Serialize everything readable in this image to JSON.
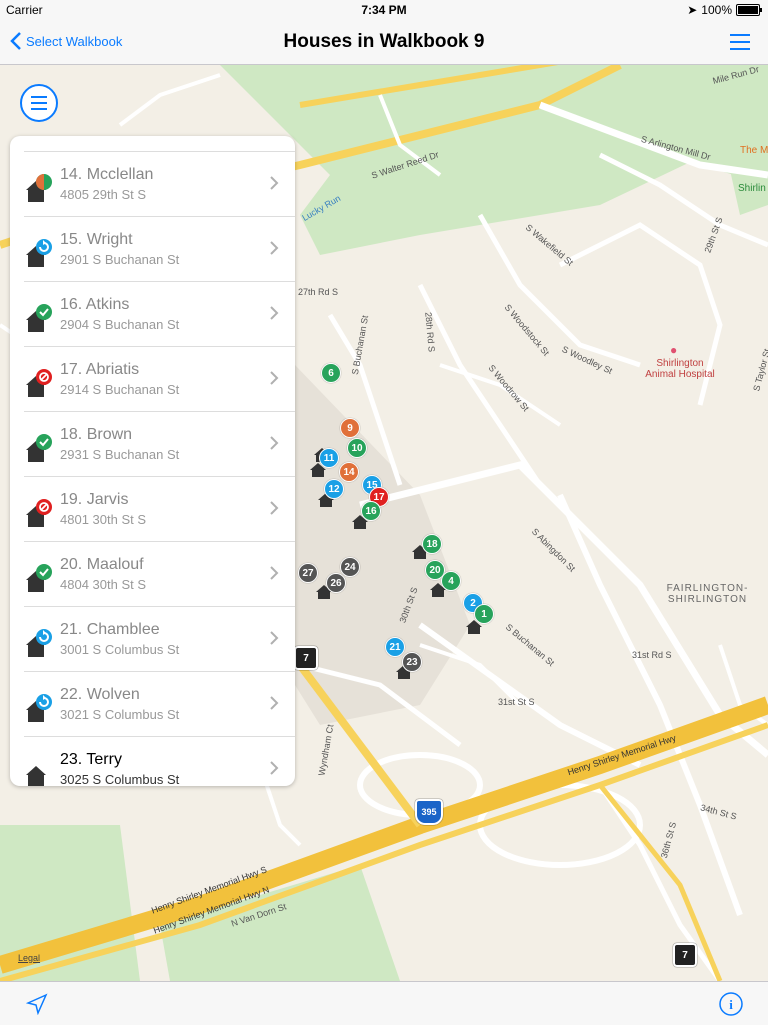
{
  "status": {
    "carrier": "Carrier",
    "time": "7:34 PM",
    "battery": "100%"
  },
  "nav": {
    "back_label": "Select Walkbook",
    "title": "Houses in Walkbook 9"
  },
  "colors": {
    "accent": "#0a7bff",
    "green": "#27a35b",
    "blue": "#1aa0e6",
    "red": "#e02020",
    "orange": "#e0703a",
    "dark": "#555555"
  },
  "houses": [
    {
      "label": "14. Mcclellan",
      "address": "4805 29th St S",
      "status": "split",
      "icon": "house-split-icon",
      "active": false
    },
    {
      "label": "15. Wright",
      "address": "2901 S Buchanan St",
      "status": "revisit",
      "icon": "house-revisit-icon",
      "active": false
    },
    {
      "label": "16. Atkins",
      "address": "2904 S Buchanan St",
      "status": "done",
      "icon": "house-check-icon",
      "active": false
    },
    {
      "label": "17. Abriatis",
      "address": "2914 S Buchanan St",
      "status": "refused",
      "icon": "house-refused-icon",
      "active": false
    },
    {
      "label": "18. Brown",
      "address": "2931 S Buchanan St",
      "status": "done",
      "icon": "house-check-icon",
      "active": false
    },
    {
      "label": "19. Jarvis",
      "address": "4801 30th St S",
      "status": "refused",
      "icon": "house-refused-icon",
      "active": false
    },
    {
      "label": "20. Maalouf",
      "address": "4804 30th St S",
      "status": "done",
      "icon": "house-check-icon",
      "active": false
    },
    {
      "label": "21. Chamblee",
      "address": "3001 S Columbus St",
      "status": "revisit",
      "icon": "house-revisit-icon",
      "active": false
    },
    {
      "label": "22. Wolven",
      "address": "3021 S Columbus St",
      "status": "revisit",
      "icon": "house-revisit-icon",
      "active": false
    },
    {
      "label": "23. Terry",
      "address": "3025 S Columbus St",
      "status": "none",
      "icon": "house-icon",
      "active": true
    }
  ],
  "map": {
    "legal": "Legal",
    "labels": {
      "walter_reed": "S Walter Reed Dr",
      "arlington_mill": "S Arlington Mill Dr",
      "lucky_run": "Lucky Run",
      "wakefield": "S Wakefield St",
      "woodstock": "S Woodstock St",
      "woodley": "S Woodley St",
      "woodrow": "S Woodrow St",
      "shirlington_animal": "Shirlington Animal Hospital",
      "abingdon": "S Abingdon St",
      "fairlington": "FAIRLINGTON-SHIRLINGTON",
      "buchanan": "S Buchanan St",
      "st31": "31st Rd S",
      "st31b": "31st St S",
      "henry_shirley_1": "Henry Shirley Memorial Hwy",
      "henry_shirley_2": "Henry Shirley Memorial Hwy S",
      "henry_shirley_3": "Henry Shirley Memorial Hwy N",
      "van_dorn": "N Van Dorn St",
      "wyndham": "Wyndham Ct",
      "st34": "34th St S",
      "st36": "36th St S",
      "rd27": "27th Rd S",
      "rd28": "28th Rd S",
      "st29": "29th St S",
      "buchanan_v": "S Buchanan St",
      "taylor": "S Taylor St",
      "st30": "30th St S",
      "mile_run": "Mile Run Dr",
      "shirlington": "Shirlin",
      "the_m": "The M"
    },
    "shields": {
      "r7a": "7",
      "r7b": "7",
      "i395": "395"
    },
    "pins": [
      {
        "n": "6",
        "color": "green"
      },
      {
        "n": "9",
        "color": "orange"
      },
      {
        "n": "10",
        "color": "green"
      },
      {
        "n": "11",
        "color": "blue"
      },
      {
        "n": "14",
        "color": "orange"
      },
      {
        "n": "15",
        "color": "blue"
      },
      {
        "n": "12",
        "color": "blue"
      },
      {
        "n": "17",
        "color": "red"
      },
      {
        "n": "16",
        "color": "green"
      },
      {
        "n": "18",
        "color": "green"
      },
      {
        "n": "20",
        "color": "green"
      },
      {
        "n": "4",
        "color": "green"
      },
      {
        "n": "2",
        "color": "blue"
      },
      {
        "n": "1",
        "color": "green"
      },
      {
        "n": "27",
        "color": "dark"
      },
      {
        "n": "24",
        "color": "dark"
      },
      {
        "n": "26",
        "color": "dark"
      },
      {
        "n": "21",
        "color": "blue"
      },
      {
        "n": "23",
        "color": "dark"
      }
    ]
  }
}
